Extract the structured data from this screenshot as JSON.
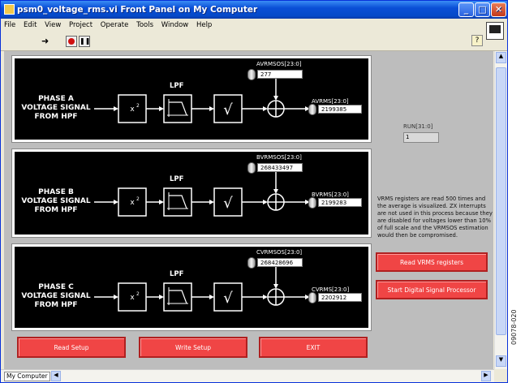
{
  "window": {
    "title": "psm0_voltage_rms.vi Front Panel on My Computer"
  },
  "menu": [
    "File",
    "Edit",
    "View",
    "Project",
    "Operate",
    "Tools",
    "Window",
    "Help"
  ],
  "phases": [
    {
      "label_lines": [
        "PHASE A",
        "VOLTAGE SIGNAL",
        "FROM HPF"
      ],
      "lpf": "LPF",
      "offset_label": "AVRMSOS[23:0]",
      "offset_value": "277",
      "rms_label": "AVRMS[23:0]",
      "rms_value": "2199385"
    },
    {
      "label_lines": [
        "PHASE B",
        "VOLTAGE SIGNAL",
        "FROM HPF"
      ],
      "lpf": "LPF",
      "offset_label": "BVRMSOS[23:0]",
      "offset_value": "268433497",
      "rms_label": "BVRMS[23:0]",
      "rms_value": "2199283"
    },
    {
      "label_lines": [
        "PHASE C",
        "VOLTAGE SIGNAL",
        "FROM HPF"
      ],
      "lpf": "LPF",
      "offset_label": "CVRMSOS[23:0]",
      "offset_value": "268428696",
      "rms_label": "CVRMS[23:0]",
      "rms_value": "2202912"
    }
  ],
  "run": {
    "label": "RUN[31:0]",
    "value": "1"
  },
  "note": "VRMS registers are read 500 times and the average is visualized. ZX interrupts are not used in this process because they are disabled for voltages lower than 10% of full scale and the VRMSOS estimation would then be compromised.",
  "buttons": {
    "read_vrms": "Read VRMS registers",
    "start_dsp": "Start Digital Signal Processor",
    "read_setup": "Read Setup",
    "write_setup": "Write Setup",
    "exit": "EXIT"
  },
  "status": "My Computer",
  "figure_id": "09078-020",
  "colors": {
    "titlebar": "#0a4fd6",
    "panel": "#bdbdbd",
    "button": "#f04545"
  }
}
